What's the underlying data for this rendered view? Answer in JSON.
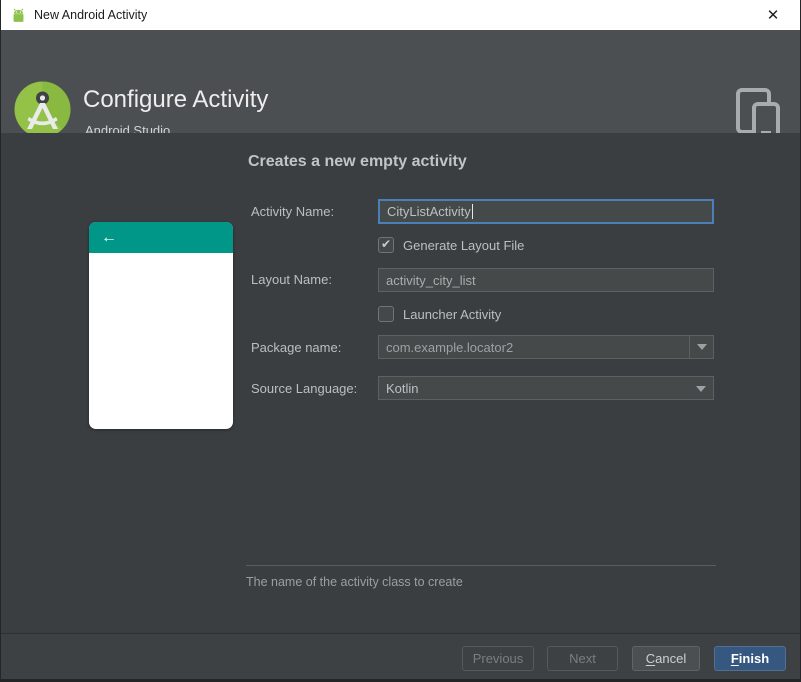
{
  "window": {
    "title": "New Android Activity",
    "close_glyph": "✕"
  },
  "header": {
    "title": "Configure Activity",
    "subtitle": "Android Studio"
  },
  "content": {
    "heading": "Creates a new empty activity",
    "preview": {
      "back_arrow": "←"
    },
    "fields": {
      "activity_name": {
        "label": "Activity Name:",
        "value": "CityListActivity",
        "focused": true
      },
      "generate_layout": {
        "label": "Generate Layout File",
        "checked": true,
        "check_glyph": "✔"
      },
      "layout_name": {
        "label": "Layout Name:",
        "value": "activity_city_list"
      },
      "launcher_activity": {
        "label": "Launcher Activity",
        "checked": false
      },
      "package_name": {
        "label": "Package name:",
        "value": "com.example.locator2"
      },
      "source_language": {
        "label": "Source Language:",
        "value": "Kotlin"
      }
    },
    "hint": "The name of the activity class to create"
  },
  "footer": {
    "previous": {
      "label": "Previous",
      "enabled": false
    },
    "next": {
      "label": "Next",
      "enabled": false
    },
    "cancel": {
      "mnemonic": "C",
      "rest": "ancel"
    },
    "finish": {
      "mnemonic": "F",
      "rest": "inish"
    }
  },
  "colors": {
    "titlebar_bg": "#ffffff",
    "header_bg": "#4c4f51",
    "body_bg": "#3a3e41",
    "preview_teal": "#009688",
    "android_green": "#94c147",
    "focus_blue": "#4a80b8",
    "finish_blue": "#365880",
    "input_bg": "#45494a"
  }
}
